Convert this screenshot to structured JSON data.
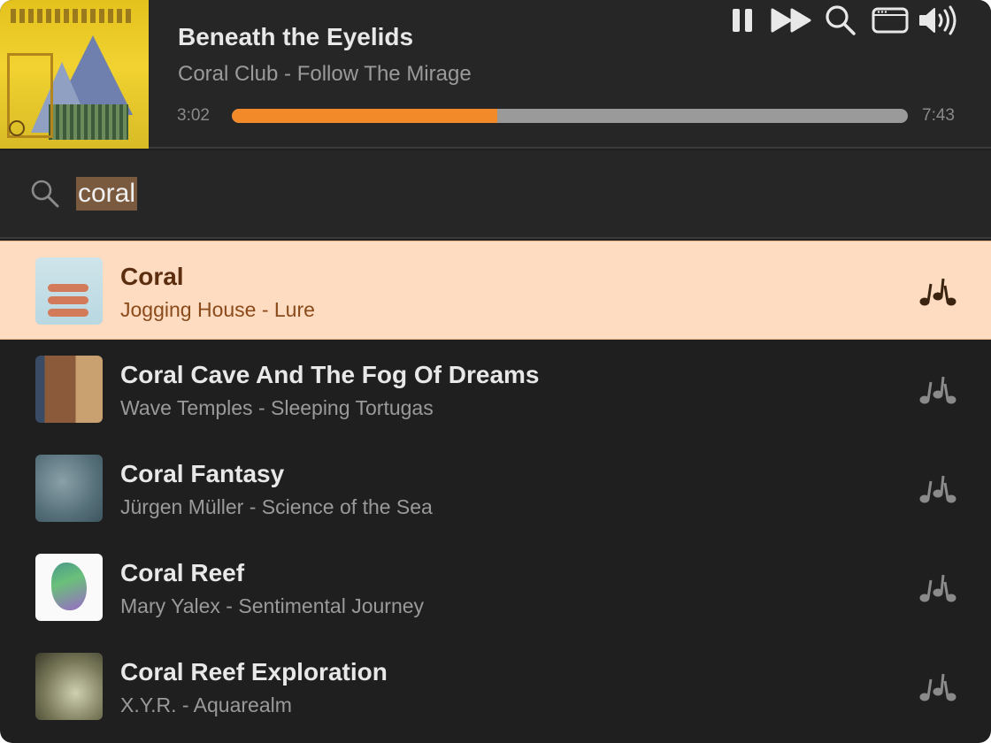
{
  "now_playing": {
    "title": "Beneath the Eyelids",
    "subtitle": "Coral Club - Follow The Mirage",
    "elapsed": "3:02",
    "total": "7:43",
    "progress": 0.393
  },
  "controls": {
    "pause_icon": "pause-icon",
    "skip_icon": "fast-forward-icon",
    "search_icon": "search-icon",
    "miniplayer_icon": "window-icon",
    "volume_icon": "speaker-volume-icon"
  },
  "search": {
    "query": "coral"
  },
  "colors": {
    "accent": "#f28a2a",
    "selected_row": "#fddcc2",
    "background": "#1f1f1f"
  },
  "results": [
    {
      "title": "Coral",
      "subtitle": "Jogging House - Lure",
      "selected": true
    },
    {
      "title": "Coral Cave And The Fog Of Dreams",
      "subtitle": "Wave Temples - Sleeping Tortugas",
      "selected": false
    },
    {
      "title": "Coral Fantasy",
      "subtitle": "Jürgen Müller - Science of the Sea",
      "selected": false
    },
    {
      "title": "Coral Reef",
      "subtitle": "Mary Yalex - Sentimental Journey",
      "selected": false
    },
    {
      "title": "Coral Reef Exploration",
      "subtitle": "X.Y.R. - Aquarealm",
      "selected": false
    }
  ]
}
